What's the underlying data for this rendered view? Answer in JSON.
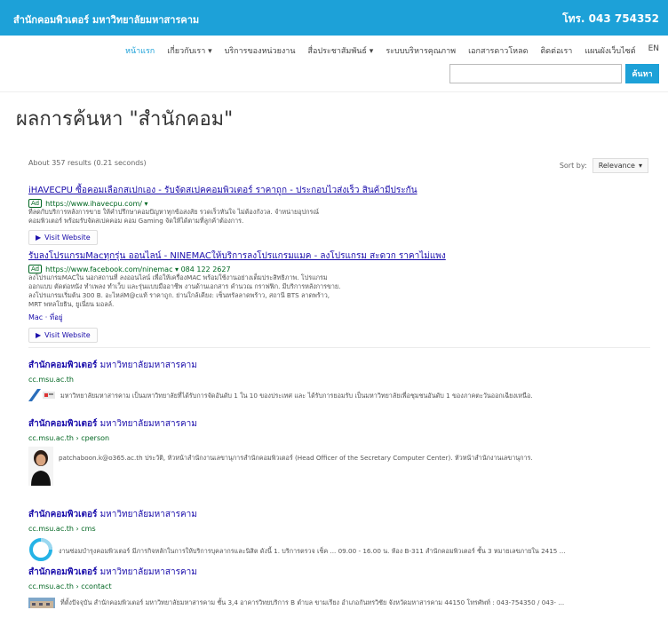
{
  "header": {
    "site_name": "สำนักคอมพิวเตอร์ มหาวิทยาลัยมหาสารคาม",
    "phone": "โทร. 043 754352",
    "bg_color": "#1da1d8"
  },
  "nav": {
    "items": [
      "หน้าแรก",
      "เกี่ยวกับเรา ▾",
      "บริการของหน่วยงาน",
      "สื่อประชาสัมพันธ์ ▾",
      "ระบบบริหารคุณภาพ",
      "เอกสารดาวโหลด",
      "ติดต่อเรา",
      "แผนผังเว็บไซต์",
      "EN"
    ],
    "active_index": 0
  },
  "search": {
    "value": "",
    "button_label": "ค้นหา"
  },
  "page_title": "ผลการค้นหา \"สำนักคอม\"",
  "stats": "About 357 results (0.21 seconds)",
  "sort": {
    "label": "Sort by:",
    "selected": "Relevance",
    "chevron_icon": "chevron-down-icon"
  },
  "ads": [
    {
      "title": "iHAVECPU ซื้อคอมเลือกสเปกเอง - รับจัดสเปคคอมพิวเตอร์ ราคาถูก - ประกอบไวส่งเร็ว สินค้ามีประกัน",
      "badge": "Ad",
      "url": "https://www.ihavecpu.com/ ▾",
      "snippet": [
        "ที่ลดกับบริการหลังการขาย ให้คำปรึกษาคอมปัญหาทุกข้อสงสัย รวดเร็วทันใจ ไม่ต้องกังวล. จำหน่ายอุปกรณ์",
        "คอมพิวเตอร์ พร้อมรับจัดสเปคคอม คอม Gaming จัดให้ได้ตามที่ลูกค้าต้องการ."
      ],
      "visit_label": "Visit Website"
    },
    {
      "title": "รับลงโปรแกรมMacทุกรุ่น ออนไลน์ - NINEMACให้บริการลงโปรแกรมแมค - ลงโปรแกรม สะดวก ราคาไม่แพง",
      "badge": "Ad",
      "url": "https://www.facebook.com/ninemac ▾   084 122 2627",
      "snippet": [
        "ลงโปรแกรมMACใน นอกสถานที่ ลงออนไลน์ เพื่อให้เครื่องMAC พร้อมใช้งานอย่างเต็มประสิทธิภาพ. โปรแกรม",
        "ออกแบบ ตัดต่อหนัง ทำเพลง ทำเว็บ และรุ่นแบบมืออาชีพ งานด้านเอกสาร คำนวณ กราฟฟิก. มีบริการหลังการขาย.",
        "ลงโปรแกรมเริ่มต้น 300 B. อะไหล่M@cแท้ ราคาถูก. ย่านใกล้เคียง: เซ็นทรัลลาดพร้าว, สถานี BTS ลาดพร้าว,",
        "MRT พหลโยธิน, ยูเนี่ยน มอลล์."
      ],
      "sitelinks": "Mac · ที่อยู่",
      "visit_label": "Visit Website"
    }
  ],
  "results": [
    {
      "title_bold": "สำนักคอมพิวเตอร์",
      "title_rest": " มหาวิทยาลัยมหาสารคาม",
      "url": "cc.msu.ac.th",
      "snippet": "มหาวิทยาลัยมหาสารคาม เป็นมหาวิทยาลัยที่ได้รับการจัดอันดับ 1 ใน 10 ของประเทศ และ ได้รับการยอมรับ เป็นมหาวิทยาลัยเพื่อชุมชนอันดับ 1 ของภาคตะวันออกเฉียงเหนือ.",
      "thumb_icon": "university-banner-icon"
    },
    {
      "title_bold": "สำนักคอมพิวเตอร์",
      "title_rest": " มหาวิทยาลัยมหาสารคาม",
      "url": "cc.msu.ac.th › cperson",
      "snippet": "patchaboon.k@o365.ac.th ประวัติ, หัวหน้าสำนักงานเลขานุการสำนักคอมพิวเตอร์ (Head Officer of the Secretary Computer Center). หัวหน้าสำนักงานเลขานุการ.",
      "thumb_icon": "person-photo-icon"
    },
    {
      "title_bold": "สำนักคอมพิวเตอร์",
      "title_rest": " มหาวิทยาลัยมหาสารคาม",
      "url": "cc.msu.ac.th › cms",
      "snippet": "งานซ่อมบำรุงคอมพิวเตอร์ มีภารกิจหลักในการให้บริการบุคลากรและนิสิต ดังนี้ 1. บริการตรวจ เช็ค ... 09.00 - 16.00 น. ห้อง B-311 สำนักคอมพิวเตอร์ ชั้น 3 หมายเลขภายใน 2415 ...",
      "thumb_icon": "circle-logo-icon"
    },
    {
      "title_bold": "สำนักคอมพิวเตอร์",
      "title_rest": " มหาวิทยาลัยมหาสารคาม",
      "url": "cc.msu.ac.th › ccontact",
      "snippet": "ที่ตั้งปัจจุบัน สำนักคอมพิวเตอร์ มหาวิทยาลัยมหาสารคาม ชั้น 3,4 อาคารวิทยบริการ B ตำบล ขามเรียง อำเภอกันทรวิชัย จังหวัดมหาสารคาม 44150 โทรศัพท์ : 043-754350 / 043- ...",
      "thumb_icon": "building-photo-icon"
    }
  ]
}
